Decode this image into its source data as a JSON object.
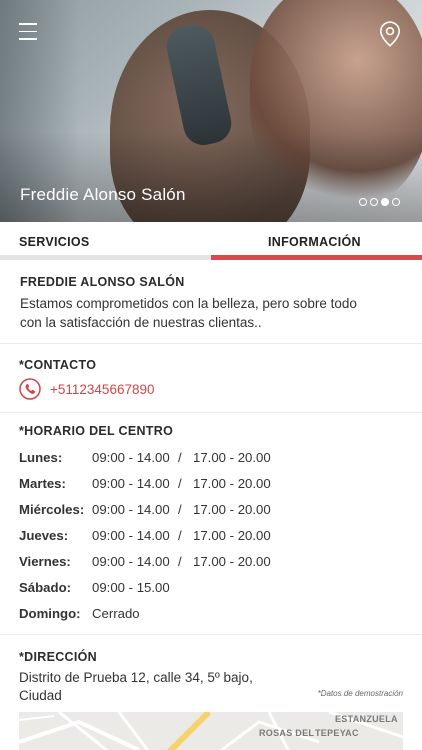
{
  "hero": {
    "title": "Freddie Alonso Salón",
    "dots": [
      false,
      false,
      true,
      false
    ]
  },
  "tabs": [
    {
      "label": "SERVICIOS",
      "active": false
    },
    {
      "label": "INFORMACIÓN",
      "active": true
    }
  ],
  "about": {
    "title": "FREDDIE ALONSO SALÓN",
    "line1": "Estamos comprometidos con la belleza, pero sobre todo",
    "line2": "con la satisfacción de nuestras clientas.."
  },
  "contact": {
    "heading": "*CONTACTO",
    "phone": "+5112345667890"
  },
  "hours": {
    "heading": "*HORARIO DEL CENTRO",
    "rows": [
      {
        "day": "Lunes:",
        "t1": "09:00 - 14.00",
        "sep": "/",
        "t2": "17.00 - 20.00"
      },
      {
        "day": "Martes:",
        "t1": "09:00 - 14.00",
        "sep": "/",
        "t2": "17.00 - 20.00"
      },
      {
        "day": "Miércoles:",
        "t1": "09:00 - 14.00",
        "sep": "/",
        "t2": "17.00 - 20.00"
      },
      {
        "day": "Jueves:",
        "t1": "09:00 - 14.00",
        "sep": "/",
        "t2": "17.00 - 20.00"
      },
      {
        "day": "Viernes:",
        "t1": "09:00 - 14.00",
        "sep": "/",
        "t2": "17.00 - 20.00"
      },
      {
        "day": "Sábado:",
        "t1": "09:00 - 15.00",
        "sep": "",
        "t2": ""
      },
      {
        "day": "Domingo:",
        "t1": "Cerrado",
        "sep": "",
        "t2": ""
      }
    ]
  },
  "address": {
    "heading": "*DIRECCIÓN",
    "line1": "Distrito de Prueba 12, calle 34, 5º bajo,",
    "line2": "Ciudad",
    "demo_note": "*Datos de demostración"
  },
  "map": {
    "labels": [
      "ESTANZUELA",
      "ROSAS DEL",
      "TEPEYAC"
    ]
  },
  "colors": {
    "accent": "#d84a4f",
    "tab_inactive": "#e4e4e4"
  }
}
